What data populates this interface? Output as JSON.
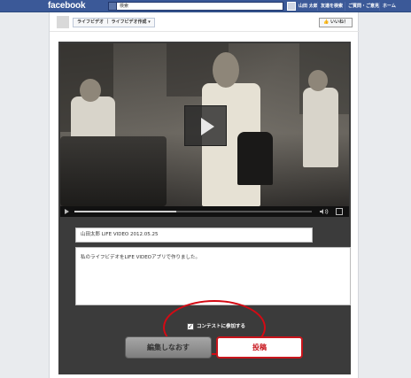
{
  "topbar": {
    "logo": "facebook",
    "search_value": "検索",
    "user_name": "山田 太郎",
    "nav": [
      "友達を検索",
      "ご質問・ご意見",
      "ホーム"
    ],
    "brand_color": "#3b5998"
  },
  "app": {
    "crumb": "ライフビデオ ｜ ライフビデオ作成 ▾",
    "like_label": "👍 いいね！"
  },
  "video": {
    "progress": 0.43,
    "icons": [
      "play-icon",
      "volume-icon",
      "fullscreen-icon"
    ]
  },
  "form": {
    "title_value": "山田太郎 LIFE VIDEO 2012.05.25",
    "description_value": "私のライフビデオをLIFE VIDEOアプリで作りました。",
    "contest_checked": true,
    "contest_label": "コンテストに参加する",
    "edit_label": "編集しなおす",
    "post_label": "投稿",
    "highlight_color": "#d40a14"
  }
}
